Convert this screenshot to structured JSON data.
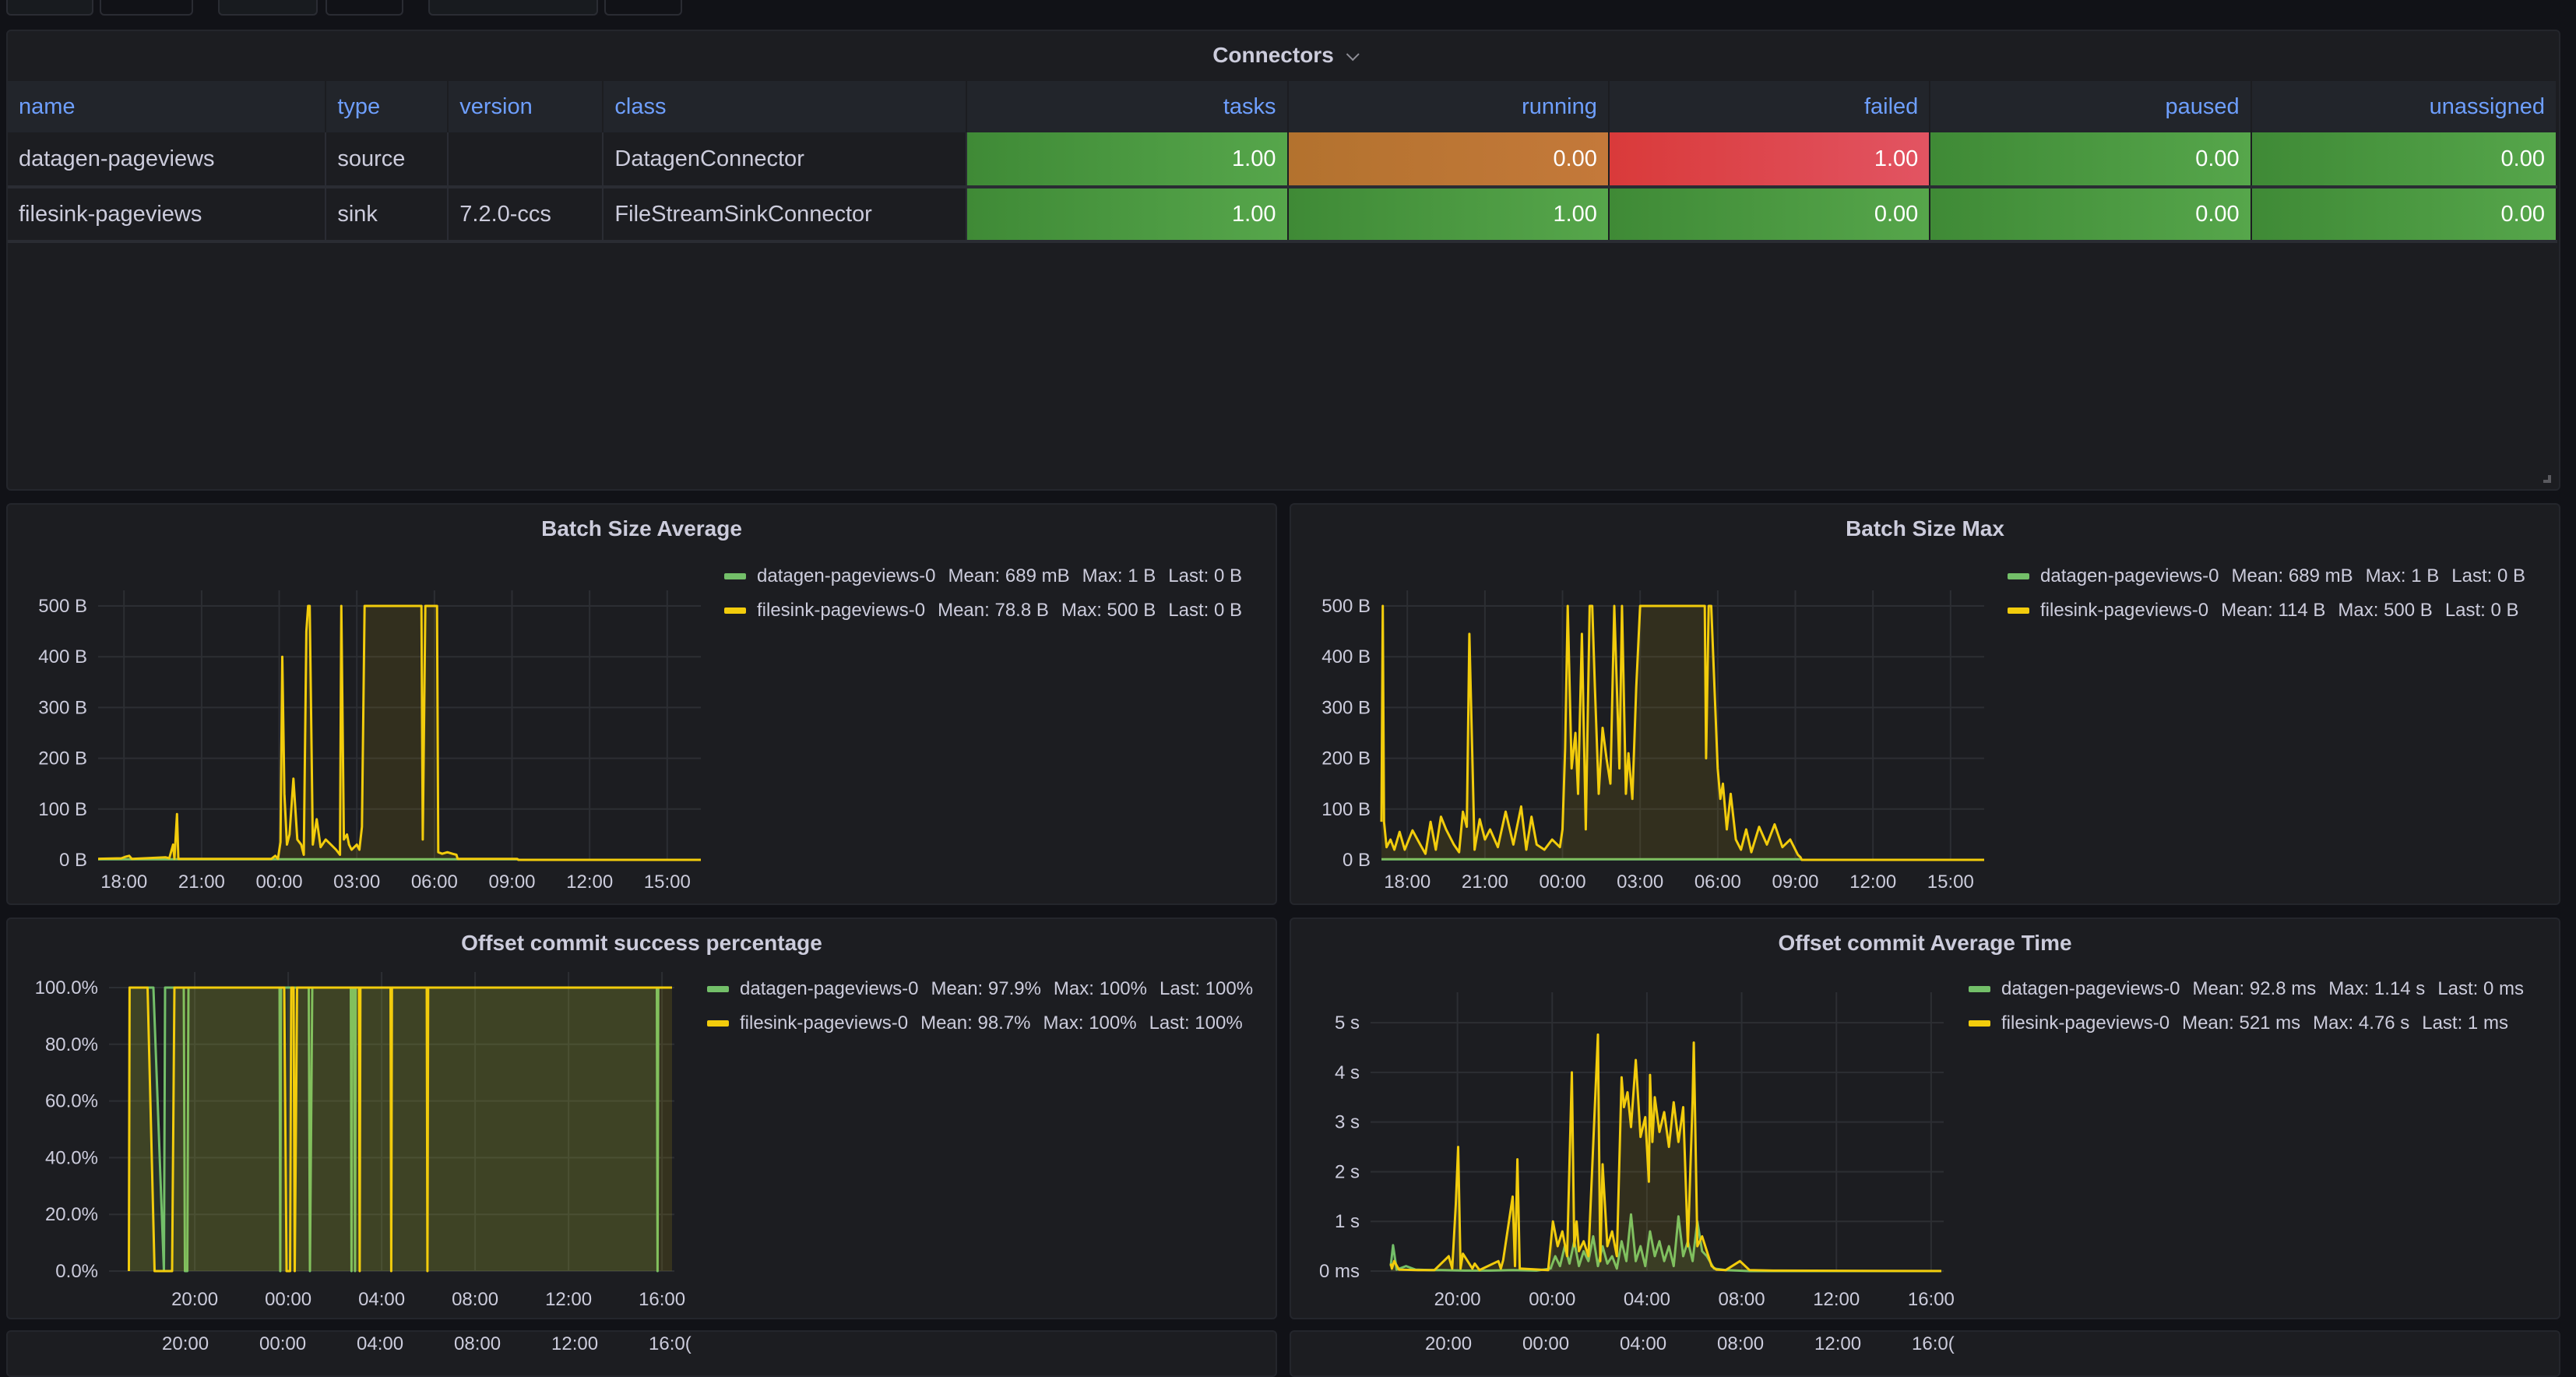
{
  "top_controls": [
    {},
    {},
    {},
    {},
    {},
    {}
  ],
  "connectors_panel": {
    "title": "Connectors",
    "columns": [
      "name",
      "type",
      "version",
      "class",
      "tasks",
      "running",
      "failed",
      "paused",
      "unassigned"
    ],
    "rows": [
      {
        "name": "datagen-pageviews",
        "type": "source",
        "version": "",
        "class": "DatagenConnector",
        "tasks": "1.00",
        "running": "0.00",
        "failed": "1.00",
        "paused": "0.00",
        "unassigned": "0.00"
      },
      {
        "name": "filesink-pageviews",
        "type": "sink",
        "version": "7.2.0-ccs",
        "class": "FileStreamSinkConnector",
        "tasks": "1.00",
        "running": "1.00",
        "failed": "0.00",
        "paused": "0.00",
        "unassigned": "0.00"
      }
    ],
    "cell_colors": {
      "green": "#56a64b",
      "orange": "#c4793a",
      "red": "#e02f44"
    },
    "row_status_colors": [
      {
        "tasks": "green",
        "running": "orange",
        "failed": "red",
        "paused": "green",
        "unassigned": "green"
      },
      {
        "tasks": "green",
        "running": "green",
        "failed": "green",
        "paused": "green",
        "unassigned": "green"
      }
    ]
  },
  "series_colors": {
    "datagen-pageviews-0": "#73bf69",
    "filesink-pageviews-0": "#f2cc0c"
  },
  "chart_data": [
    {
      "id": "batch-size-average",
      "type": "line",
      "title": "Batch Size Average",
      "xlabel": "",
      "ylabel": "",
      "x_unit": "hours since 17:00",
      "x_range": [
        0,
        23.3
      ],
      "x_ticks": [
        {
          "v": 1,
          "label": "18:00"
        },
        {
          "v": 4,
          "label": "21:00"
        },
        {
          "v": 7,
          "label": "00:00"
        },
        {
          "v": 10,
          "label": "03:00"
        },
        {
          "v": 13,
          "label": "06:00"
        },
        {
          "v": 16,
          "label": "09:00"
        },
        {
          "v": 19,
          "label": "12:00"
        },
        {
          "v": 22,
          "label": "15:00"
        }
      ],
      "ylim": [
        0,
        500
      ],
      "y_ticks": [
        {
          "v": 0,
          "label": "0 B"
        },
        {
          "v": 100,
          "label": "100 B"
        },
        {
          "v": 200,
          "label": "200 B"
        },
        {
          "v": 300,
          "label": "300 B"
        },
        {
          "v": 400,
          "label": "400 B"
        },
        {
          "v": 500,
          "label": "500 B"
        }
      ],
      "grid": true,
      "legend_position": "right",
      "legend": [
        {
          "name": "datagen-pageviews-0",
          "mean": "Mean: 689 mB",
          "max": "Max: 1 B",
          "last": "Last: 0 B"
        },
        {
          "name": "filesink-pageviews-0",
          "mean": "Mean: 78.8 B",
          "max": "Max: 500 B",
          "last": "Last: 0 B"
        }
      ],
      "series": [
        {
          "name": "datagen-pageviews-0",
          "x": [
            0,
            16.2,
            16.25,
            23.3
          ],
          "values": [
            1,
            1,
            0,
            0
          ]
        },
        {
          "name": "filesink-pageviews-0",
          "x": [
            0,
            0.9,
            1.05,
            1.2,
            1.3,
            2.6,
            2.75,
            2.9,
            2.95,
            3.05,
            3.1,
            6.7,
            6.85,
            6.95,
            7.05,
            7.12,
            7.2,
            7.3,
            7.4,
            7.55,
            7.7,
            7.85,
            7.95,
            8.05,
            8.12,
            8.18,
            8.3,
            8.45,
            8.6,
            8.8,
            9.0,
            9.2,
            9.35,
            9.4,
            9.5,
            9.62,
            9.7,
            9.8,
            9.9,
            10.0,
            10.1,
            10.2,
            10.3,
            10.5,
            12.5,
            12.55,
            12.65,
            12.75,
            13.1,
            13.15,
            13.3,
            13.5,
            13.7,
            13.85,
            13.9,
            16.2,
            16.25,
            23.3
          ],
          "values": [
            2,
            3,
            6,
            8,
            2,
            5,
            3,
            30,
            2,
            90,
            2,
            2,
            8,
            2,
            35,
            400,
            130,
            30,
            50,
            160,
            40,
            30,
            10,
            450,
            500,
            500,
            30,
            80,
            25,
            40,
            30,
            20,
            10,
            500,
            40,
            50,
            30,
            20,
            25,
            30,
            20,
            65,
            500,
            500,
            500,
            40,
            500,
            500,
            500,
            15,
            12,
            15,
            12,
            10,
            2,
            2,
            0,
            0
          ]
        }
      ]
    },
    {
      "id": "batch-size-max",
      "type": "line",
      "title": "Batch Size Max",
      "xlabel": "",
      "ylabel": "",
      "x_unit": "hours since 17:00",
      "x_range": [
        0,
        23.3
      ],
      "x_ticks": [
        {
          "v": 1,
          "label": "18:00"
        },
        {
          "v": 4,
          "label": "21:00"
        },
        {
          "v": 7,
          "label": "00:00"
        },
        {
          "v": 10,
          "label": "03:00"
        },
        {
          "v": 13,
          "label": "06:00"
        },
        {
          "v": 16,
          "label": "09:00"
        },
        {
          "v": 19,
          "label": "12:00"
        },
        {
          "v": 22,
          "label": "15:00"
        }
      ],
      "ylim": [
        0,
        500
      ],
      "y_ticks": [
        {
          "v": 0,
          "label": "0 B"
        },
        {
          "v": 100,
          "label": "100 B"
        },
        {
          "v": 200,
          "label": "200 B"
        },
        {
          "v": 300,
          "label": "300 B"
        },
        {
          "v": 400,
          "label": "400 B"
        },
        {
          "v": 500,
          "label": "500 B"
        }
      ],
      "grid": true,
      "legend_position": "right",
      "legend": [
        {
          "name": "datagen-pageviews-0",
          "mean": "Mean: 689 mB",
          "max": "Max: 1 B",
          "last": "Last: 0 B"
        },
        {
          "name": "filesink-pageviews-0",
          "mean": "Mean: 114 B",
          "max": "Max: 500 B",
          "last": "Last: 0 B"
        }
      ],
      "series": [
        {
          "name": "datagen-pageviews-0",
          "x": [
            0,
            16.2,
            16.25,
            23.3
          ],
          "values": [
            1,
            1,
            0,
            0
          ]
        },
        {
          "name": "filesink-pageviews-0",
          "x": [
            0,
            0.05,
            0.1,
            0.2,
            0.35,
            0.5,
            0.7,
            0.9,
            1.2,
            1.5,
            1.7,
            1.9,
            2.1,
            2.3,
            2.5,
            2.8,
            3.0,
            3.15,
            3.3,
            3.4,
            3.6,
            3.8,
            4.0,
            4.2,
            4.5,
            4.8,
            5.1,
            5.4,
            5.6,
            5.8,
            6.0,
            6.3,
            6.6,
            6.9,
            7.0,
            7.1,
            7.2,
            7.35,
            7.5,
            7.6,
            7.75,
            7.9,
            8.05,
            8.15,
            8.25,
            8.4,
            8.55,
            8.7,
            8.85,
            9.0,
            9.2,
            9.3,
            9.45,
            9.55,
            9.7,
            9.85,
            10.0,
            10.3,
            12.5,
            12.55,
            12.65,
            12.75,
            13.0,
            13.1,
            13.2,
            13.35,
            13.5,
            13.7,
            13.9,
            14.1,
            14.3,
            14.6,
            14.9,
            15.2,
            15.5,
            15.8,
            16.1,
            16.2,
            16.25,
            23.3
          ],
          "values": [
            75,
            500,
            75,
            25,
            40,
            20,
            55,
            20,
            58,
            30,
            12,
            75,
            20,
            85,
            60,
            30,
            15,
            95,
            65,
            445,
            20,
            80,
            40,
            60,
            25,
            95,
            30,
            105,
            20,
            85,
            30,
            20,
            40,
            25,
            60,
            220,
            500,
            180,
            250,
            130,
            445,
            60,
            500,
            500,
            340,
            130,
            260,
            200,
            150,
            500,
            180,
            500,
            130,
            210,
            120,
            340,
            500,
            500,
            500,
            200,
            500,
            500,
            180,
            120,
            150,
            60,
            130,
            40,
            20,
            60,
            15,
            65,
            30,
            70,
            25,
            40,
            10,
            5,
            0,
            0
          ]
        }
      ]
    },
    {
      "id": "offset-commit-success-percentage",
      "type": "line",
      "title": "Offset commit success percentage",
      "xlabel": "",
      "ylabel": "",
      "x_unit": "hours since 16:20",
      "x_range": [
        0,
        24.2
      ],
      "x_ticks": [
        {
          "v": 3.67,
          "label": "20:00"
        },
        {
          "v": 7.67,
          "label": "00:00"
        },
        {
          "v": 11.67,
          "label": "04:00"
        },
        {
          "v": 15.67,
          "label": "08:00"
        },
        {
          "v": 19.67,
          "label": "12:00"
        },
        {
          "v": 23.67,
          "label": "16:00"
        }
      ],
      "ylim": [
        0,
        100
      ],
      "y_ticks": [
        {
          "v": 0,
          "label": "0.0%"
        },
        {
          "v": 20,
          "label": "20.0%"
        },
        {
          "v": 40,
          "label": "40.0%"
        },
        {
          "v": 60,
          "label": "60.0%"
        },
        {
          "v": 80,
          "label": "80.0%"
        },
        {
          "v": 100,
          "label": "100.0%"
        }
      ],
      "grid": true,
      "legend_position": "right",
      "legend": [
        {
          "name": "datagen-pageviews-0",
          "mean": "Mean: 97.9%",
          "max": "Max: 100%",
          "last": "Last: 100%"
        },
        {
          "name": "filesink-pageviews-0",
          "mean": "Mean: 98.7%",
          "max": "Max: 100%",
          "last": "Last: 100%"
        }
      ],
      "series": [
        {
          "name": "datagen-pageviews-0",
          "x": [
            0.85,
            1.9,
            2.35,
            2.4,
            3.2,
            3.25,
            3.35,
            3.4,
            3.55,
            7.3,
            7.33,
            7.36,
            8.55,
            8.6,
            8.7,
            10.35,
            10.38,
            10.41,
            10.5,
            10.53,
            10.56,
            23.45,
            23.48,
            23.51
          ],
          "values": [
            100,
            100,
            0,
            100,
            100,
            0,
            0,
            100,
            100,
            100,
            0,
            100,
            100,
            0,
            100,
            100,
            0,
            100,
            100,
            0,
            100,
            100,
            0,
            100
          ]
        },
        {
          "name": "filesink-pageviews-0",
          "x": [
            0.85,
            0.88,
            0.92,
            1.65,
            1.95,
            2.7,
            2.8,
            7.5,
            7.6,
            7.75,
            7.8,
            7.9,
            7.95,
            8.05,
            10.7,
            10.73,
            10.76,
            12.05,
            12.08,
            12.11,
            13.6,
            13.63,
            13.66,
            24.1
          ],
          "values": [
            0,
            100,
            100,
            100,
            0,
            0,
            100,
            100,
            0,
            0,
            100,
            100,
            0,
            100,
            100,
            0,
            100,
            100,
            0,
            100,
            100,
            0,
            100,
            100
          ]
        }
      ]
    },
    {
      "id": "offset-commit-average-time",
      "type": "line",
      "title": "Offset commit Average Time",
      "xlabel": "",
      "ylabel": "",
      "x_unit": "hours since 16:20",
      "x_range": [
        0,
        24.2
      ],
      "x_ticks": [
        {
          "v": 3.67,
          "label": "20:00"
        },
        {
          "v": 7.67,
          "label": "00:00"
        },
        {
          "v": 11.67,
          "label": "04:00"
        },
        {
          "v": 15.67,
          "label": "08:00"
        },
        {
          "v": 19.67,
          "label": "12:00"
        },
        {
          "v": 23.67,
          "label": "16:00"
        }
      ],
      "ylim": [
        0,
        5.3
      ],
      "y_ticks": [
        {
          "v": 0,
          "label": "0 ms"
        },
        {
          "v": 1,
          "label": "1 s"
        },
        {
          "v": 2,
          "label": "2 s"
        },
        {
          "v": 3,
          "label": "3 s"
        },
        {
          "v": 4,
          "label": "4 s"
        },
        {
          "v": 5,
          "label": "5 s"
        }
      ],
      "grid": true,
      "legend_position": "right",
      "legend": [
        {
          "name": "datagen-pageviews-0",
          "mean": "Mean: 92.8 ms",
          "max": "Max: 1.14 s",
          "last": "Last: 0 ms"
        },
        {
          "name": "filesink-pageviews-0",
          "mean": "Mean: 521 ms",
          "max": "Max: 4.76 s",
          "last": "Last: 1 ms"
        }
      ],
      "series": [
        {
          "name": "datagen-pageviews-0",
          "x": [
            0.85,
            0.95,
            1.1,
            1.5,
            1.9,
            2.5,
            3.0,
            4.0,
            5.0,
            6.0,
            7.0,
            7.6,
            7.8,
            8.0,
            8.2,
            8.4,
            8.6,
            8.8,
            9.0,
            9.2,
            9.4,
            9.6,
            9.8,
            10.0,
            10.2,
            10.4,
            10.6,
            10.8,
            11.0,
            11.2,
            11.4,
            11.6,
            11.8,
            12.0,
            12.2,
            12.4,
            12.6,
            12.8,
            13.0,
            13.2,
            13.4,
            13.6,
            13.8,
            14.0,
            14.2,
            14.5,
            15.0,
            16.0,
            24.1
          ],
          "values": [
            0.1,
            0.52,
            0.03,
            0.1,
            0.03,
            0.02,
            0.02,
            0.01,
            0.01,
            0.02,
            0.01,
            0.05,
            0.3,
            0.1,
            0.5,
            0.15,
            0.6,
            0.1,
            0.4,
            0.2,
            0.7,
            0.1,
            0.5,
            0.15,
            0.3,
            0.05,
            0.6,
            0.2,
            1.14,
            0.2,
            0.5,
            0.1,
            0.8,
            0.3,
            0.6,
            0.2,
            0.5,
            0.1,
            1.1,
            0.3,
            0.6,
            0.2,
            1.0,
            0.4,
            0.3,
            0.05,
            0.02,
            0.0,
            0.0
          ]
        },
        {
          "name": "filesink-pageviews-0",
          "x": [
            0.85,
            0.9,
            1.0,
            1.2,
            2.0,
            2.7,
            3.3,
            3.45,
            3.6,
            3.7,
            3.8,
            3.9,
            4.3,
            4.4,
            4.6,
            5.4,
            5.5,
            5.6,
            6.0,
            6.1,
            6.2,
            6.3,
            7.5,
            7.7,
            7.9,
            8.1,
            8.3,
            8.5,
            8.6,
            8.7,
            8.8,
            9.0,
            9.2,
            9.6,
            9.7,
            9.8,
            10.0,
            10.2,
            10.4,
            10.6,
            10.7,
            10.85,
            11.0,
            11.2,
            11.4,
            11.6,
            11.75,
            11.8,
            11.9,
            12.0,
            12.2,
            12.4,
            12.6,
            12.8,
            13.0,
            13.2,
            13.4,
            13.6,
            13.65,
            13.8,
            14.0,
            14.2,
            14.4,
            14.6,
            15.0,
            15.6,
            16.0,
            17.0,
            24.1
          ],
          "values": [
            0.15,
            0.05,
            0.2,
            0.03,
            0.02,
            0.02,
            0.3,
            0.05,
            1.35,
            2.5,
            0.05,
            0.35,
            0.05,
            0.15,
            0.02,
            0.2,
            0.05,
            0.22,
            1.5,
            0.1,
            2.25,
            0.05,
            0.02,
            1.0,
            0.5,
            0.8,
            0.3,
            4.0,
            0.5,
            1.0,
            0.4,
            0.6,
            0.3,
            4.76,
            0.2,
            2.15,
            0.5,
            0.8,
            0.3,
            3.9,
            3.3,
            3.6,
            2.9,
            4.25,
            2.7,
            3.1,
            1.8,
            3.95,
            2.6,
            3.5,
            2.8,
            3.2,
            2.5,
            3.4,
            2.6,
            3.3,
            0.5,
            3.45,
            4.6,
            0.5,
            0.7,
            0.4,
            0.1,
            0.03,
            0.02,
            0.2,
            0.02,
            0.01,
            0.001
          ]
        }
      ]
    }
  ],
  "bottom_strip": {
    "left_ticks": [
      "20:00",
      "00:00",
      "04:00",
      "08:00",
      "12:00",
      "16:0("
    ],
    "right_ticks": [
      "20:00",
      "00:00",
      "04:00",
      "08:00",
      "12:00",
      "16:0("
    ]
  }
}
